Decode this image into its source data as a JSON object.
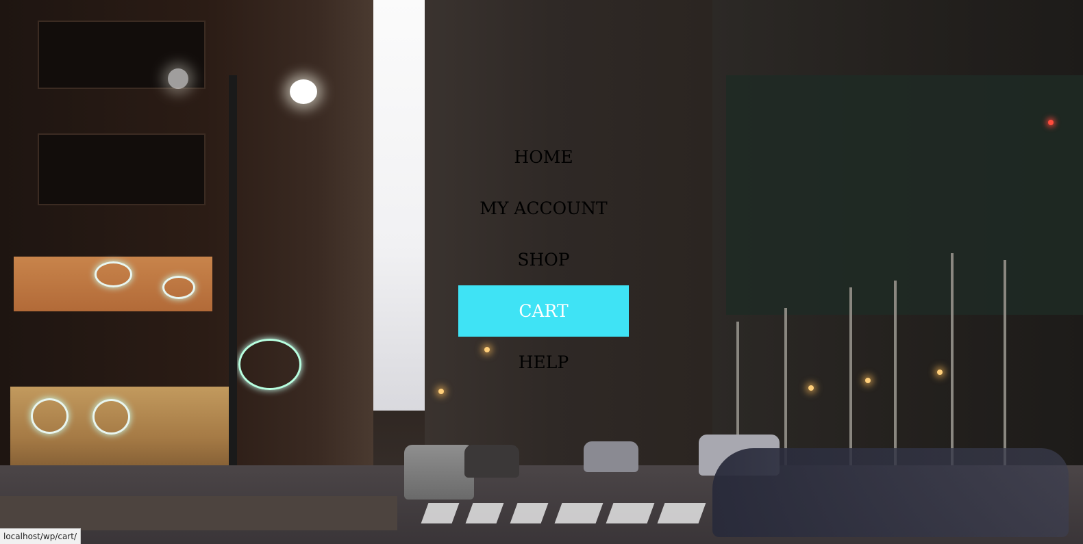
{
  "menu": {
    "items": [
      {
        "label": "HOME",
        "active": false
      },
      {
        "label": "MY ACCOUNT",
        "active": false
      },
      {
        "label": "SHOP",
        "active": false
      },
      {
        "label": "CART",
        "active": true
      },
      {
        "label": "HELP",
        "active": false
      }
    ]
  },
  "status_bar": {
    "url": "localhost/wp/cart/"
  },
  "colors": {
    "active_background": "#3fe3f5",
    "active_text": "#ffffff",
    "menu_text": "#000000"
  }
}
